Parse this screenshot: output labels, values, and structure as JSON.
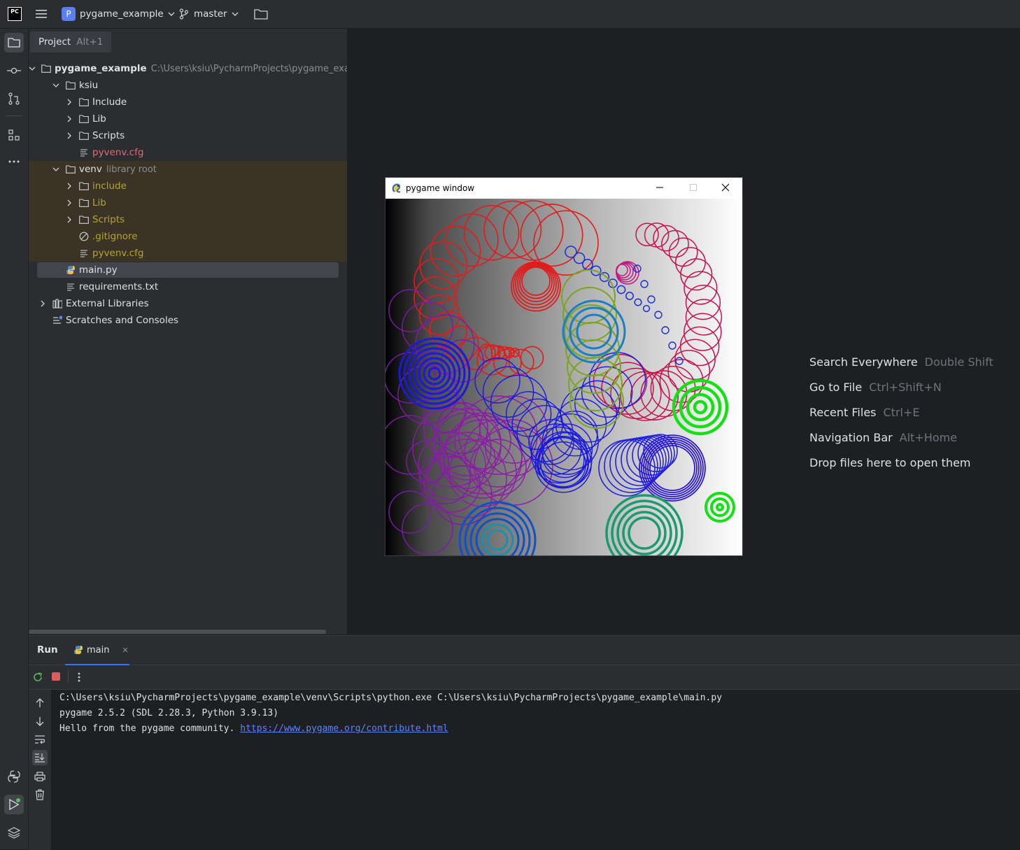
{
  "titlebar": {
    "app_logo": "PC",
    "project_letter": "P",
    "project_name": "pygame_example",
    "branch": "master"
  },
  "project_panel": {
    "title": "Project",
    "shortcut": "Alt+1",
    "tree": [
      {
        "label": "pygame_example",
        "hint": "C:\\Users\\ksiu\\PycharmProjects\\pygame_example",
        "type": "folder",
        "level": 0,
        "expanded": true,
        "color": "#dfe1e5",
        "bold": true
      },
      {
        "label": "ksiu",
        "type": "folder",
        "level": 1,
        "expanded": true,
        "color": "#dfe1e5"
      },
      {
        "label": "Include",
        "type": "folder",
        "level": 2,
        "expanded": false,
        "color": "#dfe1e5"
      },
      {
        "label": "Lib",
        "type": "folder",
        "level": 2,
        "expanded": false,
        "color": "#dfe1e5"
      },
      {
        "label": "Scripts",
        "type": "folder",
        "level": 2,
        "expanded": false,
        "color": "#dfe1e5"
      },
      {
        "label": "pyvenv.cfg",
        "type": "text",
        "level": 2,
        "color": "#e06c75"
      },
      {
        "label": "venv",
        "hint": "library root",
        "type": "folder",
        "level": 1,
        "expanded": true,
        "color": "#dfe1e5"
      },
      {
        "label": "include",
        "type": "folder",
        "level": 2,
        "expanded": false,
        "color": "#b5a52f"
      },
      {
        "label": "Lib",
        "type": "folder",
        "level": 2,
        "expanded": false,
        "color": "#b5a52f"
      },
      {
        "label": "Scripts",
        "type": "folder",
        "level": 2,
        "expanded": false,
        "color": "#b5a52f"
      },
      {
        "label": ".gitignore",
        "type": "ignore",
        "level": 2,
        "color": "#b5a52f"
      },
      {
        "label": "pyvenv.cfg",
        "type": "text",
        "level": 2,
        "color": "#b5a52f"
      },
      {
        "label": "main.py",
        "type": "python",
        "level": 1,
        "color": "#dfe1e5",
        "selected": true
      },
      {
        "label": "requirements.txt",
        "type": "text",
        "level": 1,
        "color": "#dfe1e5"
      },
      {
        "label": "External Libraries",
        "type": "library",
        "level": 0,
        "expanded": false,
        "color": "#dfe1e5"
      },
      {
        "label": "Scratches and Consoles",
        "type": "scratch",
        "level": 0,
        "color": "#dfe1e5"
      }
    ]
  },
  "empty_editor": {
    "items": [
      {
        "label": "Search Everywhere",
        "shortcut": "Double Shift"
      },
      {
        "label": "Go to File",
        "shortcut": "Ctrl+Shift+N"
      },
      {
        "label": "Recent Files",
        "shortcut": "Ctrl+E"
      },
      {
        "label": "Navigation Bar",
        "shortcut": "Alt+Home"
      },
      {
        "label": "Drop files here to open them",
        "shortcut": ""
      }
    ]
  },
  "pygame_window": {
    "title": "pygame window"
  },
  "run_panel": {
    "tab_run": "Run",
    "tab_main": "main",
    "console": {
      "line1": "C:\\Users\\ksiu\\PycharmProjects\\pygame_example\\venv\\Scripts\\python.exe C:\\Users\\ksiu\\PycharmProjects\\pygame_example\\main.py",
      "line2": "pygame 2.5.2 (SDL 2.28.3, Python 3.9.13)",
      "line3_text": "Hello from the pygame community. ",
      "line3_link": "https://www.pygame.org/contribute.html"
    }
  },
  "colors": {
    "ide_bg": "#1e1f22",
    "panel_bg": "#2b2d30",
    "accent": "#3574f0",
    "library_root_highlight": "#3b3426",
    "unversioned": "#e06c75",
    "excluded": "#b5a52f"
  }
}
